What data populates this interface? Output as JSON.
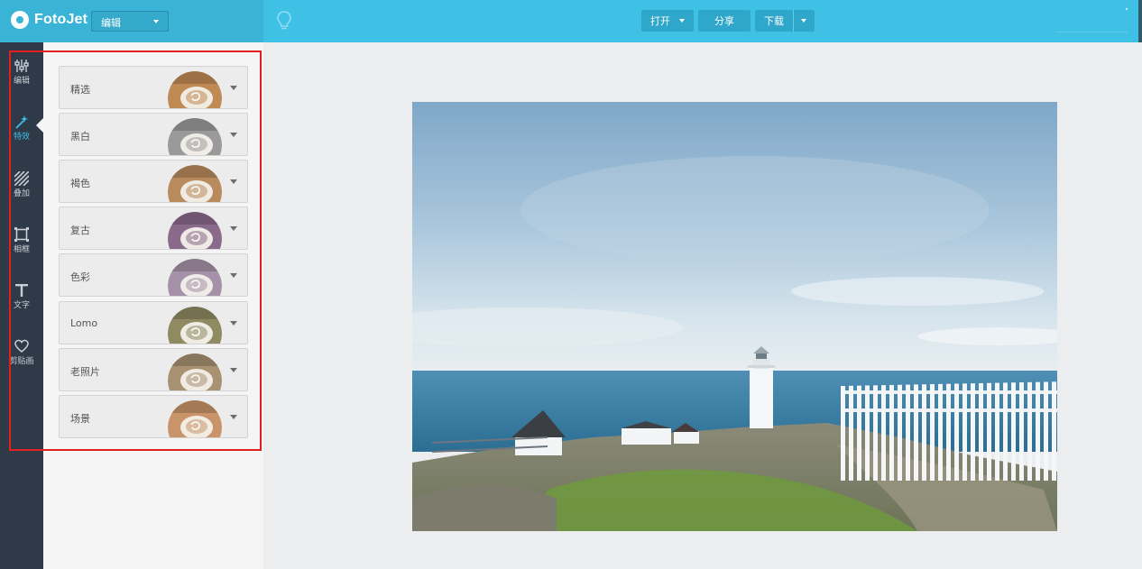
{
  "app": {
    "name": "FotoJet",
    "mode": "编辑",
    "logo_icon": "fotojet-logo-icon"
  },
  "toolbar": {
    "tip_icon": "lightbulb-icon",
    "open_label": "打开",
    "share_label": "分享",
    "download_label": "下载"
  },
  "sidebar": {
    "items": [
      {
        "label": "编辑",
        "icon": "sliders-icon"
      },
      {
        "label": "特效",
        "icon": "magic-wand-icon",
        "active": true
      },
      {
        "label": "叠加",
        "icon": "stripes-icon"
      },
      {
        "label": "相框",
        "icon": "frame-icon"
      },
      {
        "label": "文字",
        "icon": "text-icon"
      },
      {
        "label": "剪贴画",
        "icon": "heart-icon"
      }
    ]
  },
  "effects": {
    "items": [
      {
        "label": "精选",
        "tint": "#c08a55"
      },
      {
        "label": "黑白",
        "tint": "#9a9a9a"
      },
      {
        "label": "褐色",
        "tint": "#b88a5c"
      },
      {
        "label": "复古",
        "tint": "#8a6a8a"
      },
      {
        "label": "色彩",
        "tint": "#a692a8"
      },
      {
        "label": "Lomo",
        "tint": "#8f8a62"
      },
      {
        "label": "老照片",
        "tint": "#a89272"
      },
      {
        "label": "场景",
        "tint": "#c9946a"
      }
    ]
  },
  "colors": {
    "topbar": "#3fc1e5",
    "sidebar": "#2f3a48",
    "active": "#3fc1e5",
    "highlight": "#e0201e"
  },
  "canvas": {
    "photo_subject": "lighthouse-landscape-photo"
  }
}
